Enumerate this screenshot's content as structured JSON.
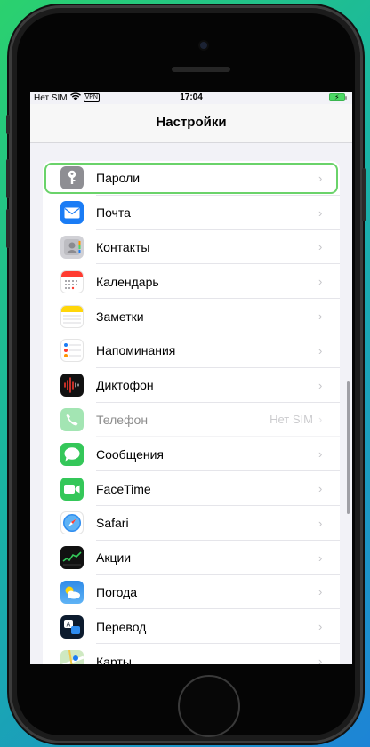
{
  "status_bar": {
    "carrier": "Нет SIM",
    "vpn": "VPN",
    "time": "17:04"
  },
  "nav": {
    "title": "Настройки"
  },
  "settings": [
    {
      "label": "Пароли",
      "value": "",
      "icon": "key-icon",
      "highlighted": true
    },
    {
      "label": "Почта",
      "value": "",
      "icon": "mail-icon"
    },
    {
      "label": "Контакты",
      "value": "",
      "icon": "contacts-icon"
    },
    {
      "label": "Календарь",
      "value": "",
      "icon": "calendar-icon"
    },
    {
      "label": "Заметки",
      "value": "",
      "icon": "notes-icon"
    },
    {
      "label": "Напоминания",
      "value": "",
      "icon": "reminders-icon"
    },
    {
      "label": "Диктофон",
      "value": "",
      "icon": "voice-memos-icon"
    },
    {
      "label": "Телефон",
      "value": "Нет SIM",
      "icon": "phone-icon",
      "disabled": true
    },
    {
      "label": "Сообщения",
      "value": "",
      "icon": "messages-icon"
    },
    {
      "label": "FaceTime",
      "value": "",
      "icon": "facetime-icon"
    },
    {
      "label": "Safari",
      "value": "",
      "icon": "safari-icon"
    },
    {
      "label": "Акции",
      "value": "",
      "icon": "stocks-icon"
    },
    {
      "label": "Погода",
      "value": "",
      "icon": "weather-icon"
    },
    {
      "label": "Перевод",
      "value": "",
      "icon": "translate-icon"
    },
    {
      "label": "Карты",
      "value": "",
      "icon": "maps-icon"
    }
  ],
  "colors": {
    "highlight": "#6ad36a",
    "background": "#f2f2f7"
  }
}
